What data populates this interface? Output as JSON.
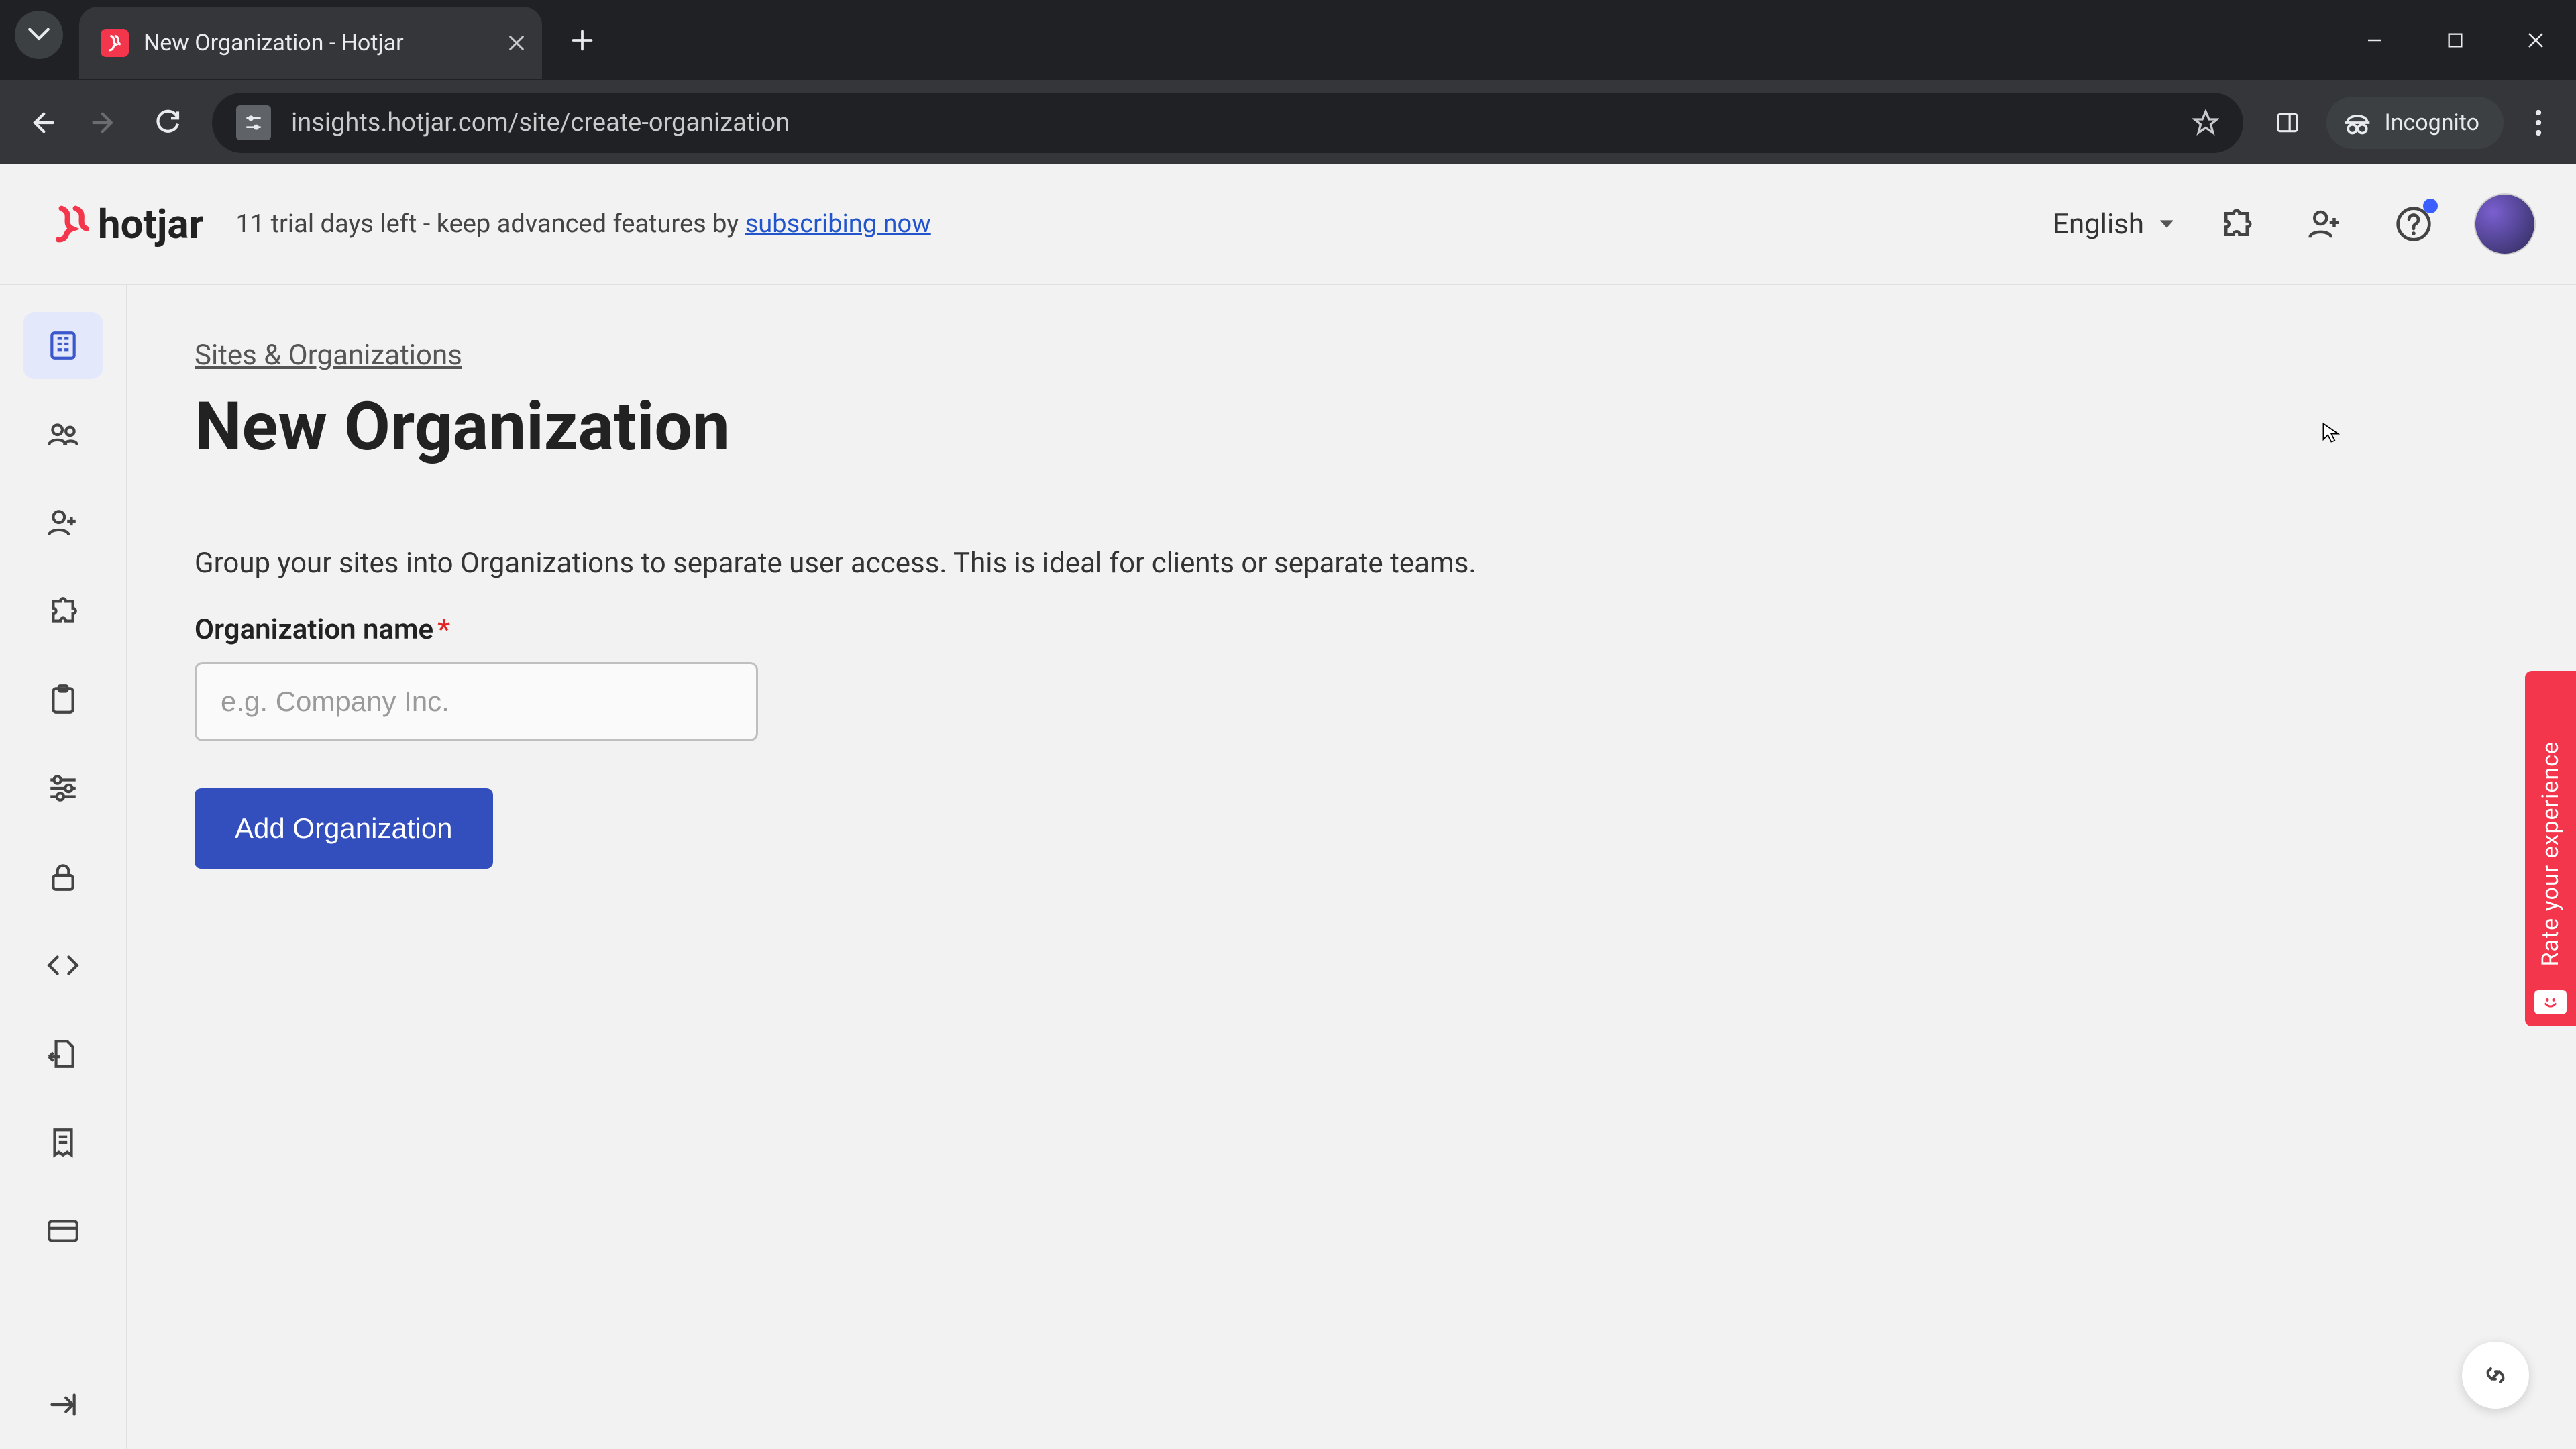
{
  "browser": {
    "tabTitle": "New Organization - Hotjar",
    "url": "insights.hotjar.com/site/create-organization",
    "incognitoLabel": "Incognito"
  },
  "header": {
    "brand": "hotjar",
    "trialPrefix": "11 trial days left - keep advanced features by ",
    "trialLink": "subscribing now",
    "language": "English"
  },
  "sidebar": {
    "items": [
      {
        "name": "sites",
        "active": true
      },
      {
        "name": "team"
      },
      {
        "name": "invite"
      },
      {
        "name": "integrations"
      },
      {
        "name": "clipboard"
      },
      {
        "name": "settings"
      },
      {
        "name": "lock"
      },
      {
        "name": "code"
      },
      {
        "name": "export"
      },
      {
        "name": "receipts"
      },
      {
        "name": "billing"
      }
    ]
  },
  "page": {
    "breadcrumb": "Sites & Organizations",
    "title": "New Organization",
    "intro": "Group your sites into Organizations to separate user access. This is ideal for clients or separate teams.",
    "orgNameLabel": "Organization name",
    "orgNamePlaceholder": "e.g. Company Inc.",
    "submitLabel": "Add Organization"
  },
  "feedback": {
    "label": "Rate your experience"
  }
}
